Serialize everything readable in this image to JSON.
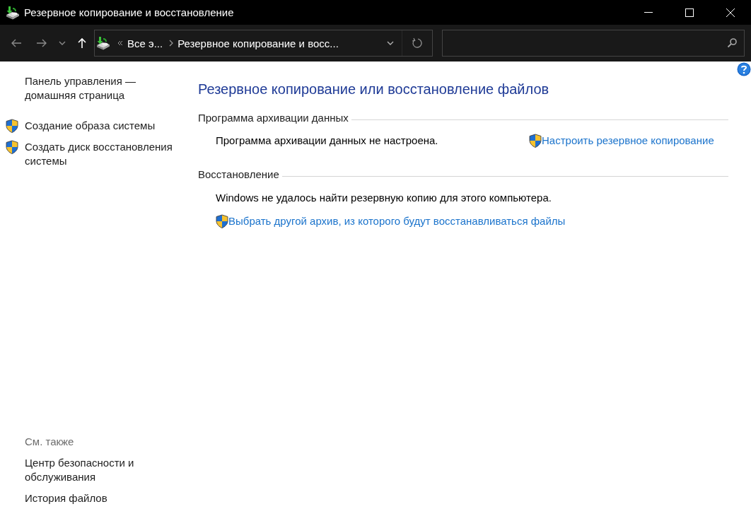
{
  "window": {
    "title": "Резервное копирование и восстановление"
  },
  "navigation": {
    "back": {
      "disabled": true
    },
    "forward": {
      "disabled": true
    },
    "recent": {
      "disabled": true
    },
    "up": {
      "disabled": false
    }
  },
  "address_bar": {
    "breadcrumbs": [
      {
        "label": "Все э..."
      },
      {
        "label": "Резервное копирование и восс..."
      }
    ]
  },
  "sidebar": {
    "links": [
      {
        "label": "Панель управления — домашняя страница",
        "kind": "plain"
      },
      {
        "label": "Создание образа системы",
        "kind": "shield"
      },
      {
        "label": "Создать диск восстановления системы",
        "kind": "shield"
      }
    ],
    "see_also": {
      "heading": "См. также",
      "links": [
        {
          "label": "Центр безопасности и обслуживания"
        },
        {
          "label": "История файлов"
        }
      ]
    }
  },
  "main": {
    "title": "Резервное копирование или восстановление файлов",
    "sections": [
      {
        "heading": "Программа архивации данных",
        "kind": "inline",
        "message": "Программа архивации данных не настроена.",
        "action": {
          "label": "Настроить резервное копирование",
          "shield": true
        }
      },
      {
        "heading": "Восстановление",
        "kind": "stacked",
        "message": "Windows не удалось найти резервную копию для этого компьютера.",
        "action": {
          "label": "Выбрать другой архив, из которого будут восстанавливаться файлы",
          "shield": true
        }
      }
    ]
  }
}
